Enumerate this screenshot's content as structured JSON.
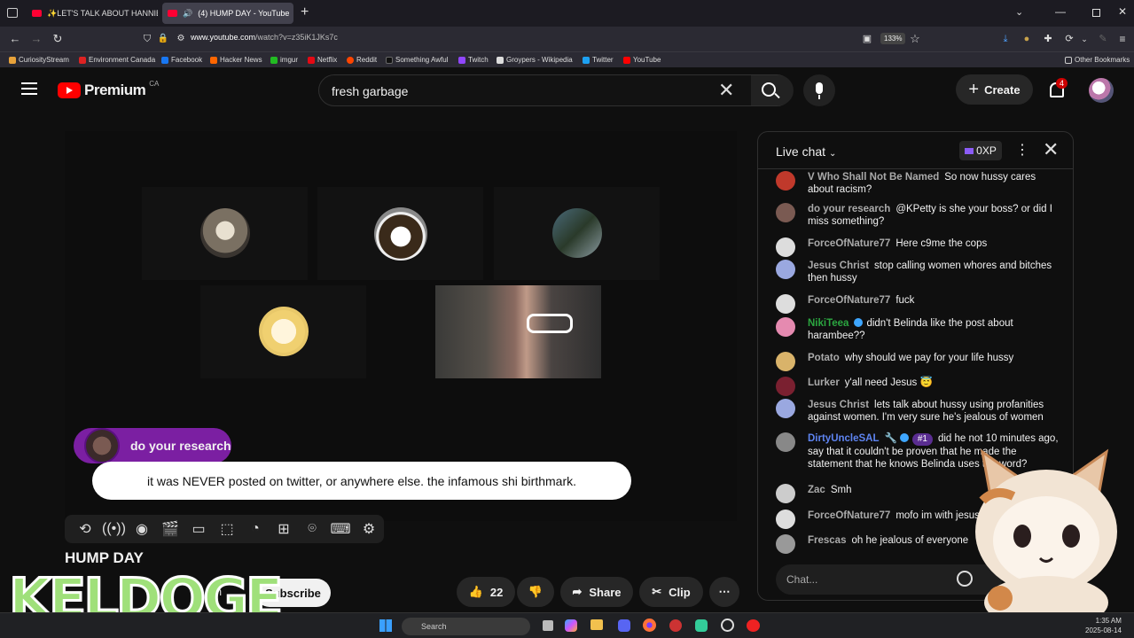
{
  "browser": {
    "tabs": [
      {
        "label": "✨LET'S TALK ABOUT HANNIB/"
      },
      {
        "label": "(4) HUMP DAY - YouTube"
      }
    ],
    "url_host": "www.youtube.com",
    "url_path": "/watch?v=z35iK1JKs7c",
    "zoom": "133%",
    "bookmarks": [
      "CuriosityStream",
      "Environment Canada",
      "Facebook",
      "Hacker News",
      "imgur",
      "Netflix",
      "Reddit",
      "Something Awful",
      "Twitch",
      "Groypers - Wikipedia",
      "Twitter",
      "YouTube"
    ],
    "other_bookmarks": "Other Bookmarks"
  },
  "youtube": {
    "logo_word": "Premium",
    "country": "CA",
    "search_value": "fresh garbage",
    "create_label": "Create",
    "notification_count": "4"
  },
  "video": {
    "caption_author": "do your research",
    "caption_text": "it was NEVER posted on twitter, or anywhere else. the infamous shi birthmark.",
    "title": "HUMP DAY",
    "join_partial": "in",
    "subscribe_label": "Subscribe",
    "like_count": "22",
    "share_label": "Share",
    "clip_label": "Clip",
    "more_label": "⋯",
    "overlay_text": "KELDOGE"
  },
  "chat": {
    "title": "Live chat",
    "xp": "0XP",
    "input_placeholder": "Chat...",
    "messages": [
      {
        "author": "V Who Shall Not Be Named",
        "text": "So now hussy cares about racism?",
        "color": "#c0392b"
      },
      {
        "author": "do your research",
        "text": "@KPetty is she your boss? or did I miss something?",
        "color": "#7a5a52"
      },
      {
        "author": "ForceOfNature77",
        "text": "Here c9me the cops",
        "color": "#ddd"
      },
      {
        "author": "Jesus Christ",
        "text": "stop calling women whores and bitches then hussy",
        "color": "#9aa8e0"
      },
      {
        "author": "ForceOfNature77",
        "text": "fuck",
        "color": "#ddd"
      },
      {
        "author": "NikiTeea",
        "text": "didn't Belinda like the post about harambee??",
        "color": "#e58ab0"
      },
      {
        "author": "Potato",
        "text": "why should we pay for your life hussy",
        "color": "#d9b36a"
      },
      {
        "author": "Lurker",
        "text": "y'all need Jesus 😇",
        "color": "#7a2030"
      },
      {
        "author": "Jesus Christ",
        "text": "lets talk about hussy using profanities against women. I'm very sure he's jealous of women",
        "color": "#9aa8e0"
      },
      {
        "author": "DirtyUncleSAL",
        "rank": "#1",
        "text": "did he not 10 minutes ago, say that it couldn't be proven that he made the statement that he knows Belinda uses the word?",
        "color": "#888"
      },
      {
        "author": "Zac",
        "text": "Smh",
        "color": "#ccc"
      },
      {
        "author": "ForceOfNature77",
        "text": "mofo im with jesus",
        "color": "#ddd"
      },
      {
        "author": "Frescas",
        "text": "oh he jealous of everyone",
        "color": "#999"
      }
    ]
  },
  "taskbar": {
    "search_label": "Search",
    "time": "1:35 AM",
    "date": "2025-08-14"
  }
}
